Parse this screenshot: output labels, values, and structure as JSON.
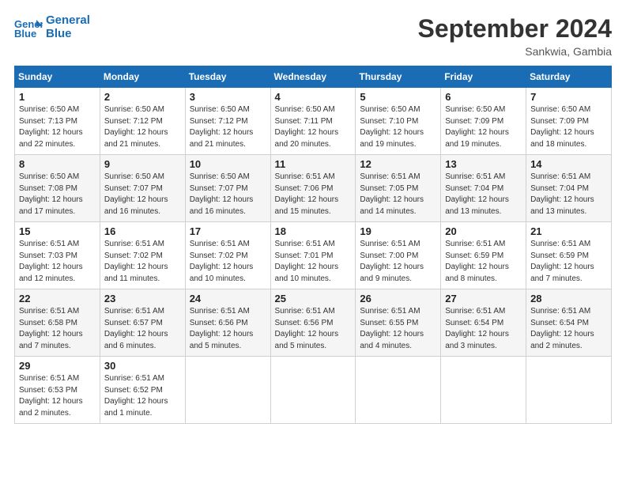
{
  "header": {
    "logo_line1": "General",
    "logo_line2": "Blue",
    "month_title": "September 2024",
    "location": "Sankwia, Gambia"
  },
  "weekdays": [
    "Sunday",
    "Monday",
    "Tuesday",
    "Wednesday",
    "Thursday",
    "Friday",
    "Saturday"
  ],
  "weeks": [
    [
      {
        "day": "1",
        "rise": "6:50 AM",
        "set": "7:13 PM",
        "hours": "12 hours and 22 minutes."
      },
      {
        "day": "2",
        "rise": "6:50 AM",
        "set": "7:12 PM",
        "hours": "12 hours and 21 minutes."
      },
      {
        "day": "3",
        "rise": "6:50 AM",
        "set": "7:12 PM",
        "hours": "12 hours and 21 minutes."
      },
      {
        "day": "4",
        "rise": "6:50 AM",
        "set": "7:11 PM",
        "hours": "12 hours and 20 minutes."
      },
      {
        "day": "5",
        "rise": "6:50 AM",
        "set": "7:10 PM",
        "hours": "12 hours and 19 minutes."
      },
      {
        "day": "6",
        "rise": "6:50 AM",
        "set": "7:09 PM",
        "hours": "12 hours and 19 minutes."
      },
      {
        "day": "7",
        "rise": "6:50 AM",
        "set": "7:09 PM",
        "hours": "12 hours and 18 minutes."
      }
    ],
    [
      {
        "day": "8",
        "rise": "6:50 AM",
        "set": "7:08 PM",
        "hours": "12 hours and 17 minutes."
      },
      {
        "day": "9",
        "rise": "6:50 AM",
        "set": "7:07 PM",
        "hours": "12 hours and 16 minutes."
      },
      {
        "day": "10",
        "rise": "6:50 AM",
        "set": "7:07 PM",
        "hours": "12 hours and 16 minutes."
      },
      {
        "day": "11",
        "rise": "6:51 AM",
        "set": "7:06 PM",
        "hours": "12 hours and 15 minutes."
      },
      {
        "day": "12",
        "rise": "6:51 AM",
        "set": "7:05 PM",
        "hours": "12 hours and 14 minutes."
      },
      {
        "day": "13",
        "rise": "6:51 AM",
        "set": "7:04 PM",
        "hours": "12 hours and 13 minutes."
      },
      {
        "day": "14",
        "rise": "6:51 AM",
        "set": "7:04 PM",
        "hours": "12 hours and 13 minutes."
      }
    ],
    [
      {
        "day": "15",
        "rise": "6:51 AM",
        "set": "7:03 PM",
        "hours": "12 hours and 12 minutes."
      },
      {
        "day": "16",
        "rise": "6:51 AM",
        "set": "7:02 PM",
        "hours": "12 hours and 11 minutes."
      },
      {
        "day": "17",
        "rise": "6:51 AM",
        "set": "7:02 PM",
        "hours": "12 hours and 10 minutes."
      },
      {
        "day": "18",
        "rise": "6:51 AM",
        "set": "7:01 PM",
        "hours": "12 hours and 10 minutes."
      },
      {
        "day": "19",
        "rise": "6:51 AM",
        "set": "7:00 PM",
        "hours": "12 hours and 9 minutes."
      },
      {
        "day": "20",
        "rise": "6:51 AM",
        "set": "6:59 PM",
        "hours": "12 hours and 8 minutes."
      },
      {
        "day": "21",
        "rise": "6:51 AM",
        "set": "6:59 PM",
        "hours": "12 hours and 7 minutes."
      }
    ],
    [
      {
        "day": "22",
        "rise": "6:51 AM",
        "set": "6:58 PM",
        "hours": "12 hours and 7 minutes."
      },
      {
        "day": "23",
        "rise": "6:51 AM",
        "set": "6:57 PM",
        "hours": "12 hours and 6 minutes."
      },
      {
        "day": "24",
        "rise": "6:51 AM",
        "set": "6:56 PM",
        "hours": "12 hours and 5 minutes."
      },
      {
        "day": "25",
        "rise": "6:51 AM",
        "set": "6:56 PM",
        "hours": "12 hours and 5 minutes."
      },
      {
        "day": "26",
        "rise": "6:51 AM",
        "set": "6:55 PM",
        "hours": "12 hours and 4 minutes."
      },
      {
        "day": "27",
        "rise": "6:51 AM",
        "set": "6:54 PM",
        "hours": "12 hours and 3 minutes."
      },
      {
        "day": "28",
        "rise": "6:51 AM",
        "set": "6:54 PM",
        "hours": "12 hours and 2 minutes."
      }
    ],
    [
      {
        "day": "29",
        "rise": "6:51 AM",
        "set": "6:53 PM",
        "hours": "12 hours and 2 minutes."
      },
      {
        "day": "30",
        "rise": "6:51 AM",
        "set": "6:52 PM",
        "hours": "12 hours and 1 minute."
      },
      null,
      null,
      null,
      null,
      null
    ]
  ],
  "labels": {
    "sunrise": "Sunrise:",
    "sunset": "Sunset:",
    "daylight": "Daylight:"
  }
}
